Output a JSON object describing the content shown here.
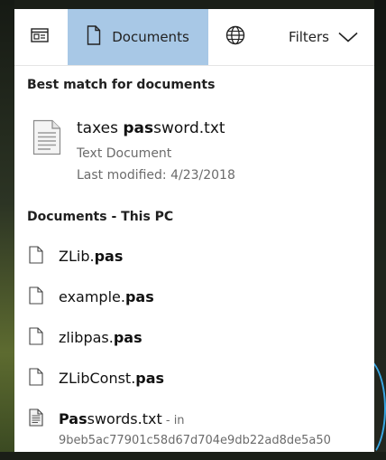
{
  "tabs": {
    "apps_icon": "app-window-icon",
    "documents_label": "Documents",
    "documents_icon": "document-icon",
    "web_icon": "globe-icon",
    "filters_label": "Filters",
    "filters_icon": "chevron-down-icon"
  },
  "best_match": {
    "header": "Best match for documents",
    "title_prefix": "taxes ",
    "title_bold": "pas",
    "title_suffix": "sword.txt",
    "type": "Text Document",
    "modified": "Last modified: 4/23/2018",
    "icon": "text-document-icon"
  },
  "documents_section": {
    "header": "Documents - This PC",
    "items": [
      {
        "prefix": "ZLib.",
        "bold": "pas",
        "icon": "file-icon"
      },
      {
        "prefix": "example.",
        "bold": "pas",
        "icon": "file-icon"
      },
      {
        "prefix": "zlibpas.",
        "bold": "pas",
        "icon": "file-icon"
      },
      {
        "prefix": "ZLibConst.",
        "bold": "pas",
        "icon": "file-icon"
      },
      {
        "prefix": "",
        "bold": "Pas",
        "suffix": "swords.txt",
        "in_text": " - in",
        "path": "9beb5ac77901c58d67d704e9db22ad8de5a50",
        "icon": "text-file-icon"
      }
    ]
  },
  "colors": {
    "selected_tab": "#a8c8e6",
    "panel_bg": "#ffffff",
    "secondary_text": "#6b6b6b"
  }
}
